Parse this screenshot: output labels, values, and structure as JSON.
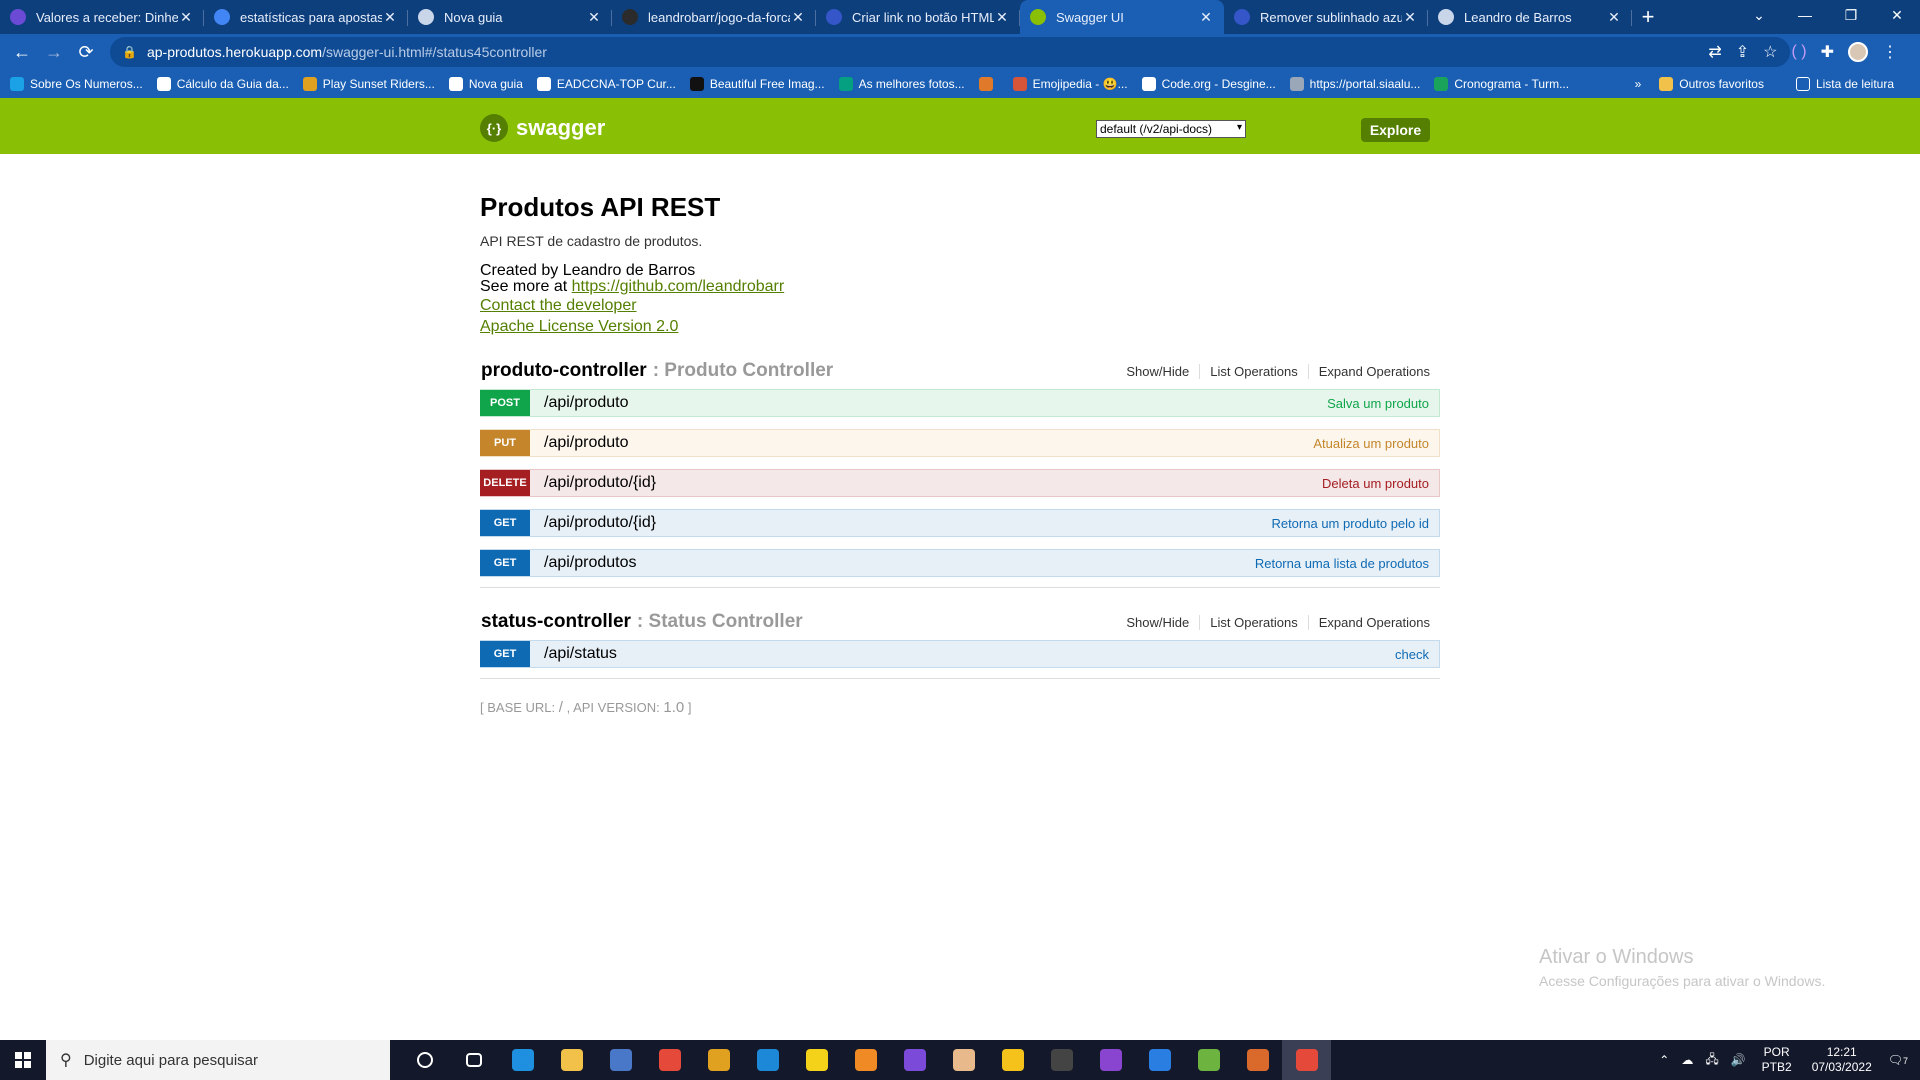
{
  "browser": {
    "tabs": [
      {
        "title": "Valores a receber: Dinheiro",
        "icon": "v-icon",
        "color": "#6b4bd6"
      },
      {
        "title": "estatísticas para apostas e",
        "icon": "google-icon",
        "color": "#4285f4"
      },
      {
        "title": "Nova guia",
        "icon": "chrome-icon",
        "color": "#c9d6ea"
      },
      {
        "title": "leandrobarr/jogo-da-forca",
        "icon": "github-icon",
        "color": "#2b2b2b"
      },
      {
        "title": "Criar link no botão HTML",
        "icon": "site-icon",
        "color": "#3456c8"
      },
      {
        "title": "Swagger UI",
        "icon": "swagger-icon",
        "color": "#89bf04",
        "active": true
      },
      {
        "title": "Remover sublinhado azul d",
        "icon": "site-icon",
        "color": "#3456c8"
      },
      {
        "title": "Leandro de Barros",
        "icon": "globe-icon",
        "color": "#c9d6ea"
      }
    ],
    "url_host": "ap-produtos.herokuapp.com",
    "url_path": "/swagger-ui.html#/status45controller",
    "bookmarks": [
      {
        "label": "Sobre Os Numeros...",
        "color": "#1aa1e6"
      },
      {
        "label": "Cálculo da Guia da...",
        "color": "#ffffff"
      },
      {
        "label": "Play Sunset Riders...",
        "color": "#e0a020"
      },
      {
        "label": "Nova guia",
        "color": "#ffffff"
      },
      {
        "label": "EADCCNA-TOP Cur...",
        "color": "#ffffff"
      },
      {
        "label": "Beautiful Free Imag...",
        "color": "#111111"
      },
      {
        "label": "As melhores fotos...",
        "color": "#05a081"
      },
      {
        "label": "",
        "color": "#e07a2a"
      },
      {
        "label": "Emojipedia - 😃...",
        "color": "#d4553a"
      },
      {
        "label": "Code.org - Desgine...",
        "color": "#ffffff"
      },
      {
        "label": "https://portal.siaalu...",
        "color": "#9aa7b8"
      },
      {
        "label": "Cronograma - Turm...",
        "color": "#19a35b"
      }
    ],
    "bookmarks_overflow": "»",
    "other_favorites": "Outros favoritos",
    "reading_list": "Lista de leitura"
  },
  "swagger": {
    "logo_text": "swagger",
    "spec_select": "default (/v2/api-docs)",
    "explore_label": "Explore",
    "title": "Produtos API REST",
    "description": "API REST de cadastro de produtos.",
    "created_by": "Created by Leandro de Barros",
    "see_more_prefix": "See more at ",
    "see_more_link": "https://github.com/leandrobarr",
    "contact": "Contact the developer",
    "license": "Apache License Version 2.0",
    "actions": {
      "show_hide": "Show/Hide",
      "list_ops": "List Operations",
      "expand_ops": "Expand Operations"
    },
    "controllers": [
      {
        "name": "produto-controller",
        "desc": ": Produto Controller",
        "operations": [
          {
            "method": "POST",
            "path": "/api/produto",
            "summary": "Salva um produto"
          },
          {
            "method": "PUT",
            "path": "/api/produto",
            "summary": "Atualiza um produto"
          },
          {
            "method": "DELETE",
            "path": "/api/produto/{id}",
            "summary": "Deleta um produto"
          },
          {
            "method": "GET",
            "path": "/api/produto/{id}",
            "summary": "Retorna um produto pelo id"
          },
          {
            "method": "GET",
            "path": "/api/produtos",
            "summary": "Retorna uma lista de produtos"
          }
        ]
      },
      {
        "name": "status-controller",
        "desc": ": Status Controller",
        "operations": [
          {
            "method": "GET",
            "path": "/api/status",
            "summary": "check"
          }
        ]
      }
    ],
    "footer": {
      "base_url_label": "BASE URL",
      "base_url": "/",
      "api_version_label": "API VERSION",
      "api_version": "1.0"
    }
  },
  "watermark": {
    "line1": "Ativar o Windows",
    "line2": "Acesse Configurações para ativar o Windows."
  },
  "taskbar": {
    "search_placeholder": "Digite aqui para pesquisar",
    "apps": [
      {
        "name": "cortana-icon",
        "color": "#14182b"
      },
      {
        "name": "task-view-icon",
        "color": "#14182b"
      },
      {
        "name": "edge-icon",
        "color": "#1f8fe0"
      },
      {
        "name": "file-explorer-icon",
        "color": "#f2c14a"
      },
      {
        "name": "photo-app-icon",
        "color": "#4a78c8"
      },
      {
        "name": "chrome-icon",
        "color": "#e5493a"
      },
      {
        "name": "pinwheel-icon",
        "color": "#e0a020"
      },
      {
        "name": "vscode-icon",
        "color": "#1d88d8"
      },
      {
        "name": "sticky-notes-icon",
        "color": "#f4d21a"
      },
      {
        "name": "sublime-icon",
        "color": "#f08a24"
      },
      {
        "name": "github-desktop-icon",
        "color": "#7c4ad8"
      },
      {
        "name": "stack-app-icon",
        "color": "#e8b98a"
      },
      {
        "name": "lightbulb-icon",
        "color": "#f4c21a"
      },
      {
        "name": "terminal-icon",
        "color": "#444444"
      },
      {
        "name": "visual-studio-icon",
        "color": "#8a45d0"
      },
      {
        "name": "app-w-icon",
        "color": "#2a7de1"
      },
      {
        "name": "spring-icon",
        "color": "#6db33f"
      },
      {
        "name": "app-bar-icon",
        "color": "#d96a2b"
      },
      {
        "name": "chrome-active-icon",
        "color": "#e5493a"
      }
    ],
    "lang_1": "POR",
    "lang_2": "PTB2",
    "time": "12:21",
    "date": "07/03/2022",
    "notifications": "7"
  }
}
